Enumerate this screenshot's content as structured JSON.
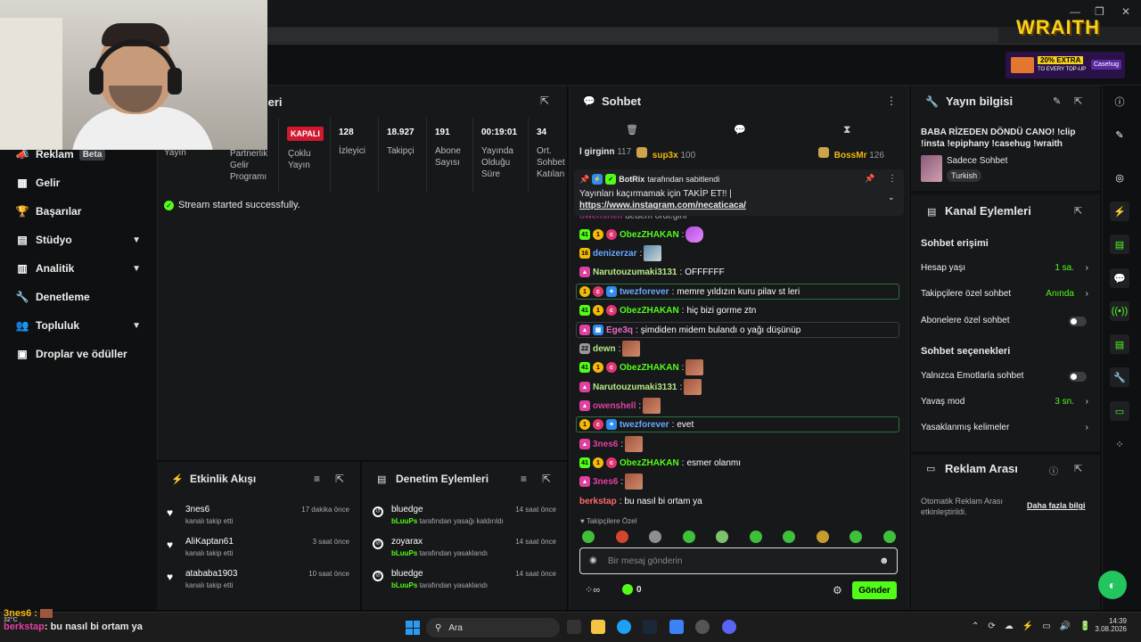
{
  "stream_overlay": {
    "wraith_logo": "WRAITH",
    "promo_text": "20% EXTRA",
    "promo_sub": "TO EVERY TOP-UP",
    "casehug": "Casehug"
  },
  "sidebar": {
    "items": [
      {
        "label": "Reklam",
        "icon": "megaphone-icon",
        "badge": "Beta"
      },
      {
        "label": "Gelir",
        "icon": "dollar-icon"
      },
      {
        "label": "Başarılar",
        "icon": "trophy-icon"
      },
      {
        "label": "Stüdyo",
        "icon": "studio-icon"
      },
      {
        "label": "Analitik",
        "icon": "chart-icon"
      },
      {
        "label": "Denetleme",
        "icon": "wrench-icon"
      },
      {
        "label": "Topluluk",
        "icon": "users-icon"
      },
      {
        "label": "Droplar ve ödüller",
        "icon": "gift-icon"
      }
    ]
  },
  "stats_panel": {
    "title_partial": "leri",
    "yayin": "Yayın",
    "partner": "Partnerlik Gelir Programı",
    "kapali": "KAPALI",
    "coklu": "Çoklu Yayın",
    "stats": [
      {
        "value": "128",
        "label": "İzleyici"
      },
      {
        "value": "18.927",
        "label": "Takipçi"
      },
      {
        "value": "191",
        "label": "Abone Sayısı"
      },
      {
        "value": "00:19:01",
        "label": "Yayında Olduğu Süre"
      },
      {
        "value": "34",
        "label": "Ort. Sohbet Katılan"
      }
    ],
    "success_msg": "Stream started successfully."
  },
  "activity": {
    "title": "Etkinlik Akışı",
    "rows": [
      {
        "name": "3nes6",
        "sub": "kanalı takip etti",
        "time": "17 dakika önce"
      },
      {
        "name": "AliKaptan61",
        "sub": "kanalı takip etti",
        "time": "3 saat önce"
      },
      {
        "name": "atababa1903",
        "sub": "kanalı takip etti",
        "time": "10 saat önce"
      }
    ]
  },
  "moderation": {
    "title": "Denetim Eylemleri",
    "rows": [
      {
        "name": "bluedge",
        "actor": "bLuuPs",
        "action": "tarafından yasağı kaldırıldı",
        "time": "14 saat önce"
      },
      {
        "name": "zoyarax",
        "actor": "bLuuPs",
        "action": "tarafından yasaklandı",
        "time": "14 saat önce"
      },
      {
        "name": "bluedge",
        "actor": "bLuuPs",
        "action": "tarafından yasaklandı",
        "time": "14 saat önce"
      }
    ]
  },
  "chat": {
    "title": "Sohbet",
    "top_users": [
      {
        "name": "l girginn",
        "count": "117"
      },
      {
        "name": "sup3x",
        "count": "100"
      },
      {
        "name": "BossMr",
        "count": "126"
      }
    ],
    "pinned": {
      "author": "BotRix",
      "pinned_by": "tarafından sabitlendi",
      "text": "Yayınları kaçırmamak için TAKİP ET!! |",
      "link": "https://www.instagram.com/necaticaca/"
    },
    "messages": [
      {
        "user": "owenshell",
        "text": "dedem ördeğini",
        "color": "#e040a0"
      },
      {
        "user": "ObezZHAKAN",
        "text": "",
        "color": "#53fc18",
        "emote": true
      },
      {
        "user": "denizerzar",
        "text": "",
        "color": "#6aa9ff",
        "emote": true
      },
      {
        "user": "Narutouzumaki3131",
        "text": "OFFFFFF",
        "color": "#b8e986"
      },
      {
        "user": "twezforever",
        "text": "memre yıldızın kuru pilav st leri",
        "color": "#6aa9ff"
      },
      {
        "user": "ObezZHAKAN",
        "text": "hiç bizi gorme ztn",
        "color": "#53fc18"
      },
      {
        "user": "Ege3q",
        "text": "şimdiden midem bulandı o yağı düşünüp",
        "color": "#e56dc1"
      },
      {
        "user": "dewn",
        "text": "",
        "color": "#b8e986",
        "emote": true
      },
      {
        "user": "ObezZHAKAN",
        "text": "",
        "color": "#53fc18",
        "emote": true
      },
      {
        "user": "Narutouzumaki3131",
        "text": "",
        "color": "#b8e986",
        "emote": true
      },
      {
        "user": "owenshell",
        "text": "",
        "color": "#e040a0",
        "emote": true
      },
      {
        "user": "twezforever",
        "text": "evet",
        "color": "#6aa9ff"
      },
      {
        "user": "3nes6",
        "text": "",
        "color": "#e040a0",
        "emote": true
      },
      {
        "user": "ObezZHAKAN",
        "text": "esmer olanmı",
        "color": "#53fc18"
      },
      {
        "user": "3nes6",
        "text": "",
        "color": "#e040a0",
        "emote": true
      },
      {
        "user": "berkstap",
        "text": "bu nasıl bi ortam ya",
        "color": "#ff6b6b"
      }
    ],
    "followers_only": "Takipçilere Özel",
    "input_placeholder": "Bir mesaj gönderin",
    "send_label": "Gönder",
    "points": "0"
  },
  "stream_info": {
    "title": "Yayın bilgisi",
    "stream_title": "BABA RİZEDEN DÖNDÜ CANO! !clip !insta !epiphany !casehug !wraith",
    "category": "Sadece Sohbet",
    "language": "Turkish"
  },
  "channel_actions": {
    "title": "Kanal Eylemleri",
    "chat_access": "Sohbet erişimi",
    "account_age": "Hesap yaşı",
    "account_age_val": "1 sa.",
    "followers_chat": "Takipçilere özel sohbet",
    "followers_chat_val": "Anında",
    "subs_chat": "Abonelere özel sohbet",
    "chat_options": "Sohbet seçenekleri",
    "emote_only": "Yalnızca Emotlarla sohbet",
    "slow_mode": "Yavaş mod",
    "slow_mode_val": "3 sn.",
    "banned_words": "Yasaklanmış kelimeler"
  },
  "ad_break": {
    "title": "Reklam Arası",
    "text": "Otomatik Reklam Arası etkinleştirildi.",
    "link": "Daha fazla bilgi"
  },
  "overlay_chat": {
    "user1": "3nes6 :",
    "user2": "berkstap",
    "msg2": ": bu nasıl bi ortam ya",
    "temp": "32°C"
  },
  "taskbar": {
    "search": "Ara",
    "time": "14:39",
    "date": "3.08.2026"
  },
  "colors": {
    "accent": "#53fc18",
    "danger": "#d1182f",
    "panel": "#16181a"
  }
}
